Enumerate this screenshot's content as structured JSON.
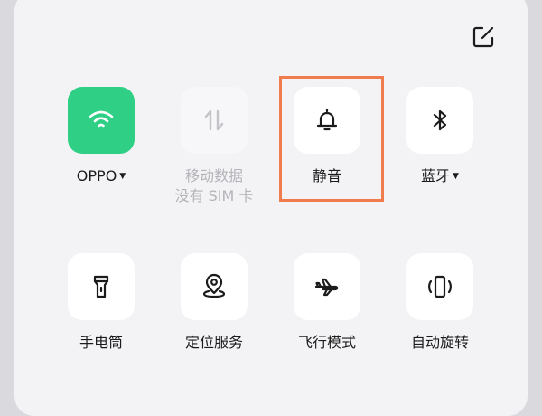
{
  "edit_icon": "edit-square-icon",
  "tiles": [
    {
      "label": "OPPO",
      "sub": "",
      "icon": "wifi-icon",
      "state": "active",
      "has_caret": true
    },
    {
      "label": "移动数据",
      "sub": "没有 SIM 卡",
      "icon": "mobile-data-icon",
      "state": "disabled",
      "has_caret": false
    },
    {
      "label": "静音",
      "sub": "",
      "icon": "bell-icon",
      "state": "normal",
      "has_caret": false
    },
    {
      "label": "蓝牙",
      "sub": "",
      "icon": "bluetooth-icon",
      "state": "normal",
      "has_caret": true
    },
    {
      "label": "手电筒",
      "sub": "",
      "icon": "flashlight-icon",
      "state": "normal",
      "has_caret": false
    },
    {
      "label": "定位服务",
      "sub": "",
      "icon": "location-icon",
      "state": "normal",
      "has_caret": false
    },
    {
      "label": "飞行模式",
      "sub": "",
      "icon": "airplane-icon",
      "state": "normal",
      "has_caret": false
    },
    {
      "label": "自动旋转",
      "sub": "",
      "icon": "auto-rotate-icon",
      "state": "normal",
      "has_caret": false
    }
  ],
  "caret_glyph": "▼",
  "colors": {
    "active_tile": "#2fcf86",
    "highlight_border": "#f07b4c",
    "disabled_text": "#b4b4b8"
  }
}
